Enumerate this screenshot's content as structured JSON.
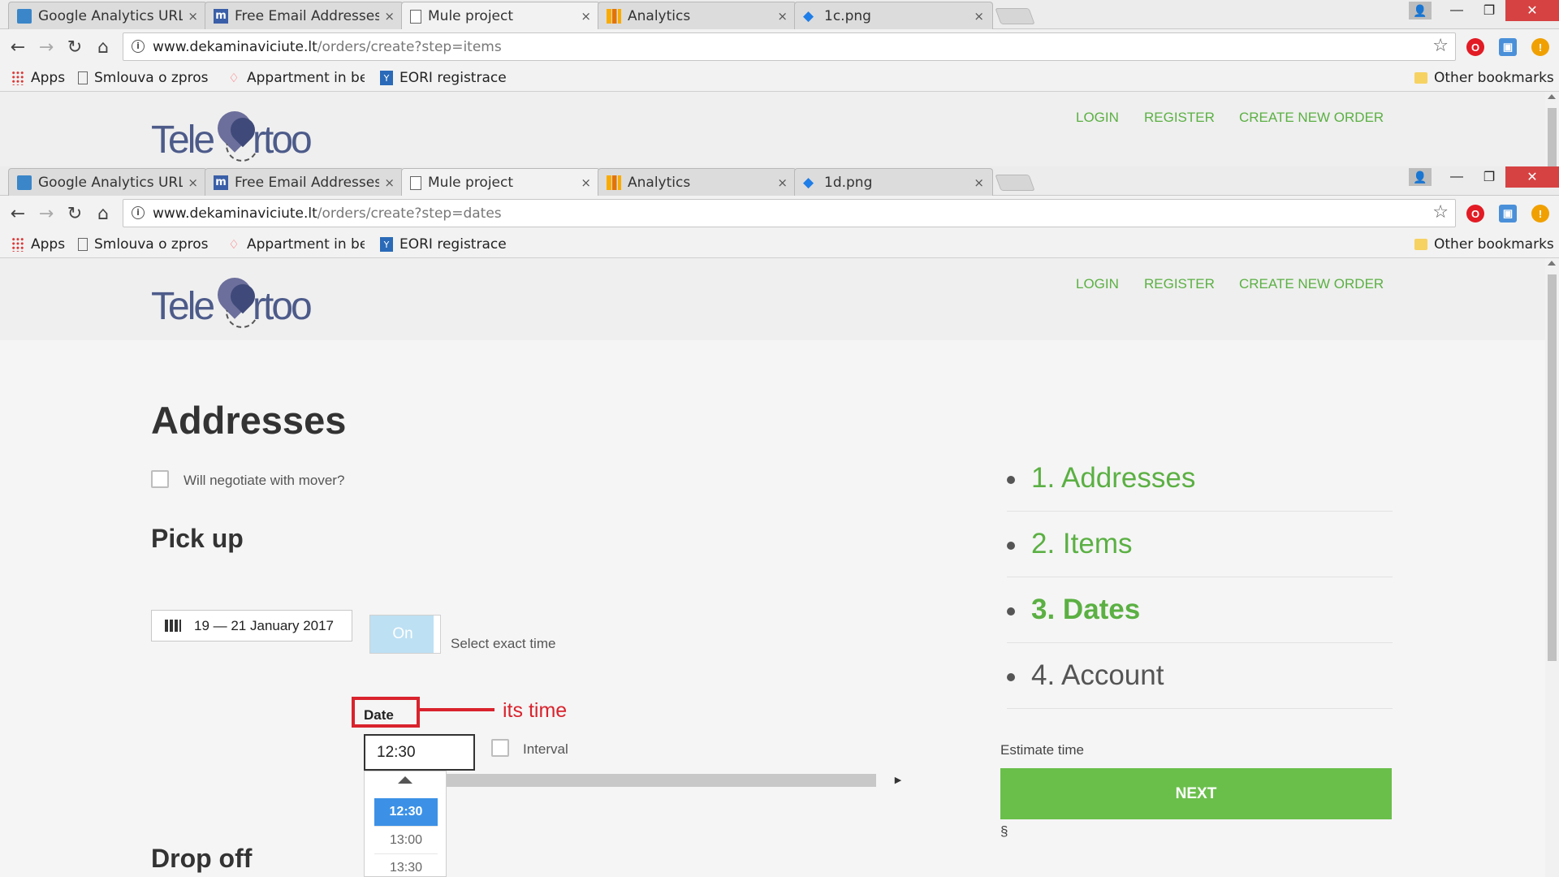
{
  "top_window": {
    "tabs": [
      {
        "label": "Google Analytics URL",
        "icon": "analytics-url-icon",
        "close": "×"
      },
      {
        "label": "Free Email Addresses",
        "icon": "mail-m-icon",
        "close": "×"
      },
      {
        "label": "Mule project",
        "icon": "page-icon",
        "close": "×",
        "active": true
      },
      {
        "label": "Analytics",
        "icon": "analytics-bars-icon",
        "close": "×"
      },
      {
        "label": "1c.png",
        "icon": "dropbox-icon",
        "close": "×"
      }
    ],
    "url_host": "www.dekaminaviciute.lt",
    "url_path": "/orders/create?step=items"
  },
  "second_window": {
    "tabs": [
      {
        "label": "Google Analytics URL",
        "icon": "analytics-url-icon",
        "close": "×"
      },
      {
        "label": "Free Email Addresses",
        "icon": "mail-m-icon",
        "close": "×"
      },
      {
        "label": "Mule project",
        "icon": "page-icon",
        "close": "×",
        "active": true
      },
      {
        "label": "Analytics",
        "icon": "analytics-bars-icon",
        "close": "×"
      },
      {
        "label": "1d.png",
        "icon": "dropbox-icon",
        "close": "×"
      }
    ],
    "url_host": "www.dekaminaviciute.lt",
    "url_path": "/orders/create?step=dates"
  },
  "window_controls": {
    "minimize": "—",
    "restore": "❐",
    "close": "✕",
    "user": "👤"
  },
  "bookmarks": {
    "apps": "Apps",
    "items": [
      "Smlouva o zprostředkování",
      "Appartment in bes",
      "EORI registrace"
    ],
    "other": "Other bookmarks"
  },
  "site": {
    "logo_left": "Tele",
    "logo_right": "rtoo",
    "nav": {
      "login": "LOGIN",
      "register": "REGISTER",
      "create": "CREATE NEW ORDER"
    }
  },
  "form": {
    "title": "Addresses",
    "negotiate_label": "Will negotiate with mover?",
    "pickup_heading": "Pick up",
    "date_range": "19 — 21 January 2017",
    "toggle_label": "On",
    "exact_time_label": "Select exact time",
    "date_label": "Date",
    "annotation": "its time",
    "time_value": "12:30",
    "interval_label": "Interval",
    "time_options": [
      "12:30",
      "13:00",
      "13:30"
    ],
    "selected_time": "12:30",
    "dropoff_heading": "Drop off"
  },
  "steps": [
    {
      "label": "1. Addresses",
      "state": "done"
    },
    {
      "label": "2. Items",
      "state": "done"
    },
    {
      "label": "3. Dates",
      "state": "current"
    },
    {
      "label": "4. Account",
      "state": "pending"
    }
  ],
  "sidebar": {
    "estimate_label": "Estimate time",
    "next_button": "NEXT",
    "section_mark": "§"
  },
  "colors": {
    "brand_green": "#5bb043",
    "button_green": "#6abf4b",
    "annotation_red": "#d9232d",
    "selected_blue": "#3c91e6",
    "logo_navy": "#4d5b8a"
  }
}
